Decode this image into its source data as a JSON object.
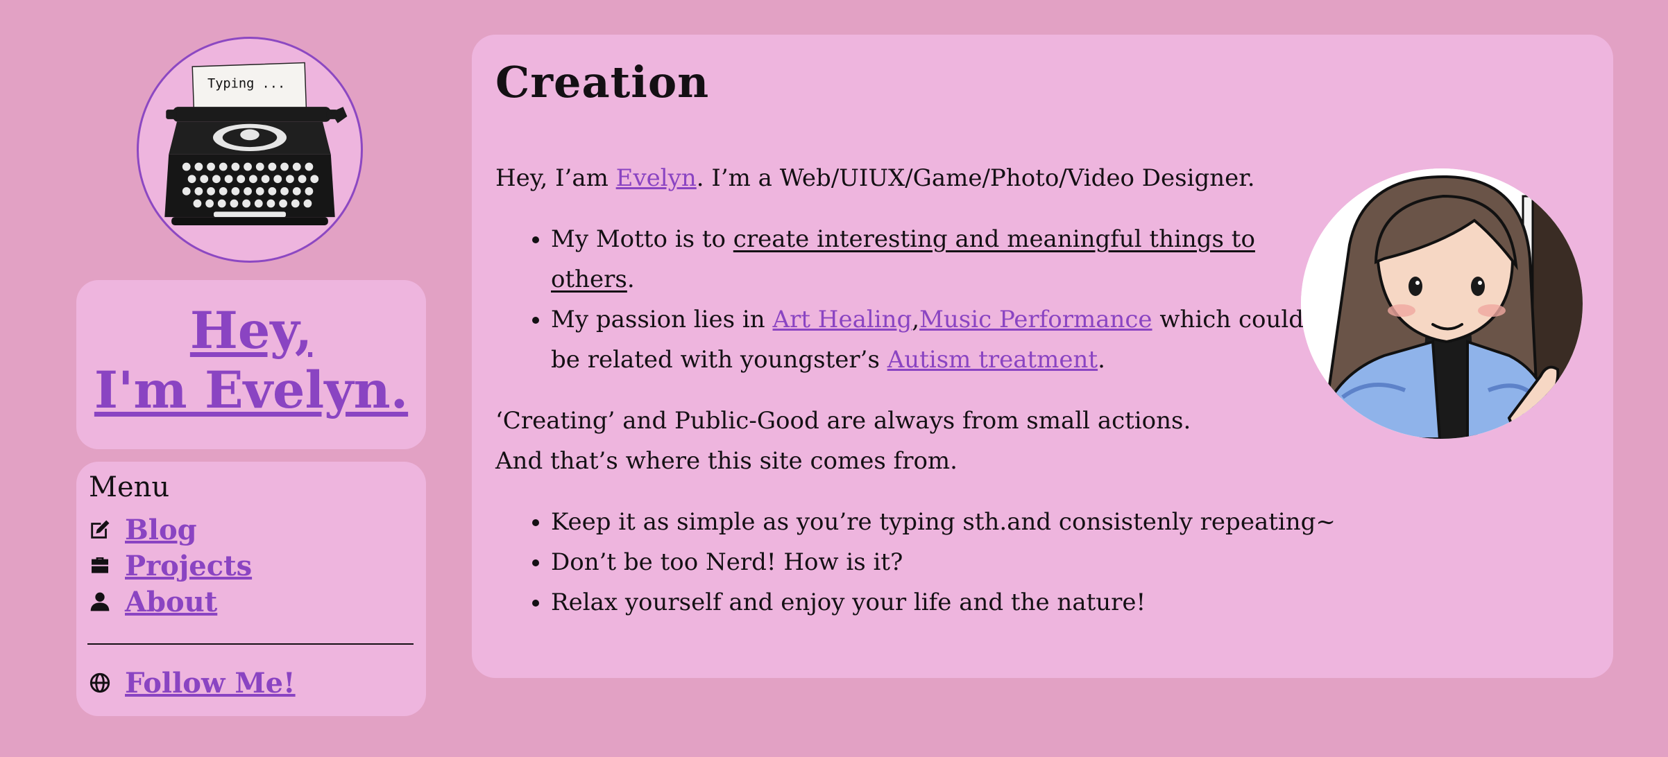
{
  "logo": {
    "paper_text": "Typing ..."
  },
  "hero": {
    "line1": "Hey,",
    "line2": "I'm Evelyn."
  },
  "menu": {
    "heading": "Menu",
    "items": [
      {
        "label": "Blog",
        "icon": "edit-icon"
      },
      {
        "label": "Projects",
        "icon": "briefcase-icon"
      },
      {
        "label": "About",
        "icon": "user-icon"
      }
    ],
    "follow": {
      "label": "Follow Me!",
      "icon": "globe-icon"
    }
  },
  "main": {
    "title": "Creation",
    "intro_prefix": "Hey, I’am ",
    "intro_link": "Evelyn",
    "intro_suffix": ". I’m a Web/UIUX/Game/Photo/Video Designer.",
    "motto_prefix": "My Motto is to ",
    "motto_underlined": "create interesting and meaningful things to others",
    "motto_suffix": ".",
    "passion_prefix": "My passion lies in ",
    "passion_link1": "Art Healing",
    "passion_comma": ",",
    "passion_link2": "Music Performance",
    "passion_mid": " which could be related with youngster’s ",
    "passion_link3": "Autism treatment",
    "passion_suffix": ".",
    "para_line1": "‘Creating’ and Public-Good are always from small actions.",
    "para_line2": "And that’s where this site comes from.",
    "bullets": [
      "Keep it as simple as you’re typing sth.and consistenly repeating~",
      "Don’t be too Nerd! How is it?",
      "Relax yourself and enjoy your life and the nature!"
    ]
  },
  "colors": {
    "background": "#e2a1c4",
    "card": "#eeb5de",
    "link": "#8a44c2",
    "text": "#141014"
  }
}
